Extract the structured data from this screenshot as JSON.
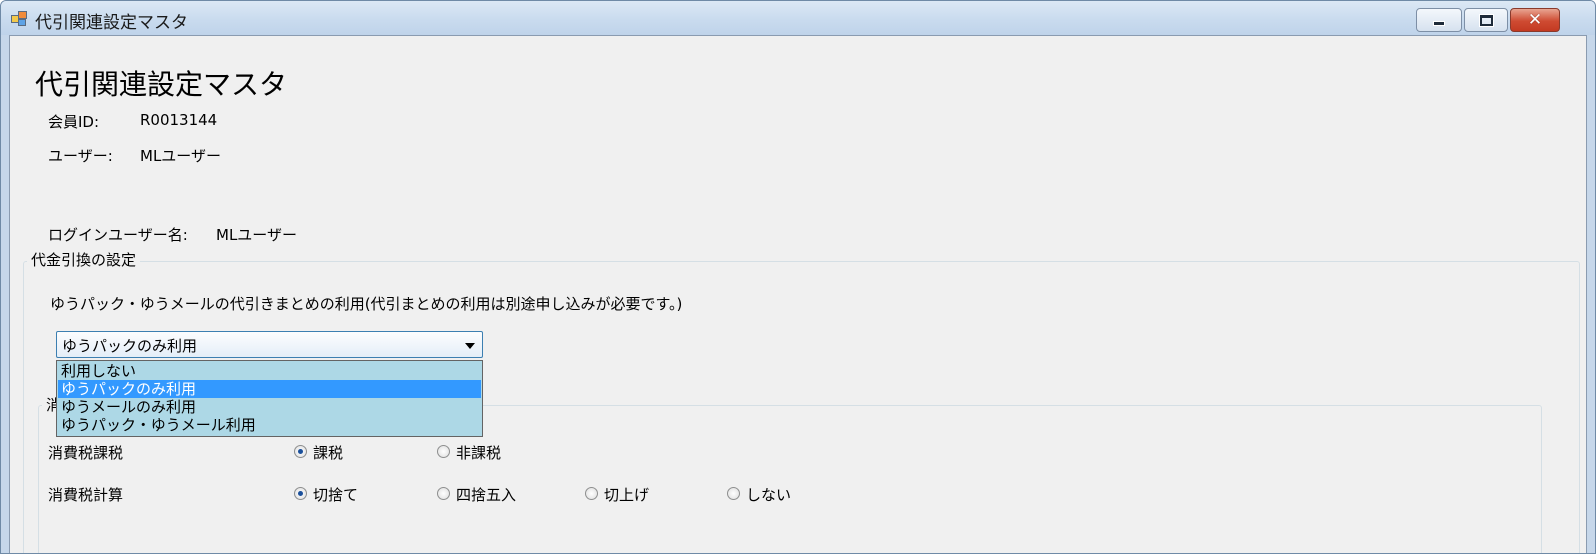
{
  "window": {
    "title": "代引関連設定マスタ",
    "controls": {
      "minimize_icon": "minimize-icon",
      "maximize_icon": "maximize-icon",
      "close_label": "✕"
    }
  },
  "header": {
    "title": "代引関連設定マスタ",
    "member_id_label": "会員ID:",
    "member_id_value": "R0013144",
    "user_label": "ユーザー:",
    "user_value": "MLユーザー",
    "login_user_label": "ログインユーザー名:",
    "login_user_value": "MLユーザー"
  },
  "cod_settings": {
    "group_title": "代金引換の設定",
    "description": "ゆうパック・ゆうメールの代引きまとめの利用(代引まとめの利用は別途申し込みが必要です。)",
    "combo": {
      "selected": "ゆうパックのみ利用",
      "options": [
        "利用しない",
        "ゆうパックのみ利用",
        "ゆうメールのみ利用",
        "ゆうパック・ゆうメール利用"
      ],
      "highlighted_index": 1
    }
  },
  "tax_settings": {
    "group_title_partial": "消",
    "taxation": {
      "label": "消費税課税",
      "options": [
        {
          "label": "課税",
          "checked": true
        },
        {
          "label": "非課税",
          "checked": false
        }
      ]
    },
    "calculation": {
      "label": "消費税計算",
      "options": [
        {
          "label": "切捨て",
          "checked": true
        },
        {
          "label": "四捨五入",
          "checked": false
        },
        {
          "label": "切上げ",
          "checked": false
        },
        {
          "label": "しない",
          "checked": false
        }
      ]
    }
  },
  "colors": {
    "client_bg": "#f0f0f0",
    "dropdown_bg": "#add8e6",
    "selection": "#3399ff",
    "titlebar": "#c9dbee"
  }
}
